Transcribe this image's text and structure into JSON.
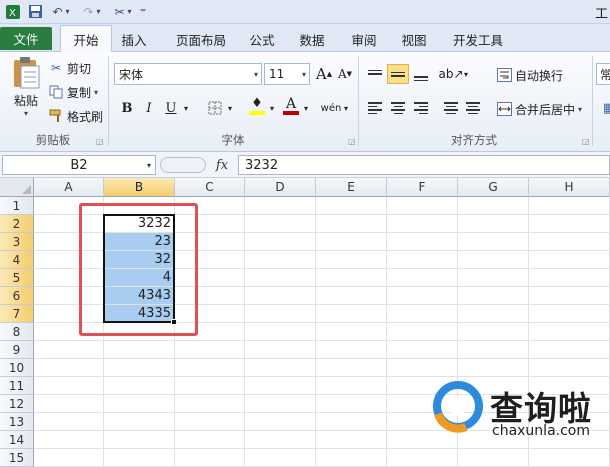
{
  "qat": {
    "title_fragment": "工"
  },
  "tabs": [
    {
      "label": "文件"
    },
    {
      "label": "开始"
    },
    {
      "label": "插入"
    },
    {
      "label": "页面布局"
    },
    {
      "label": "公式"
    },
    {
      "label": "数据"
    },
    {
      "label": "审阅"
    },
    {
      "label": "视图"
    },
    {
      "label": "开发工具"
    }
  ],
  "ribbon": {
    "clipboard": {
      "paste_label": "粘贴",
      "cut_label": "剪切",
      "copy_label": "复制",
      "format_painter_label": "格式刷",
      "group_label": "剪贴板"
    },
    "font": {
      "font_name": "宋体",
      "font_size": "11",
      "bold": "B",
      "italic": "I",
      "underline": "U",
      "grow": "A",
      "shrink": "A",
      "group_label": "字体",
      "font_color": "#c00000",
      "fill_color": "#ffff00"
    },
    "alignment": {
      "wrap_label": "自动换行",
      "merge_label": "合并后居中",
      "group_label": "对齐方式"
    },
    "number": {
      "format_fragment": "常"
    }
  },
  "formula_bar": {
    "name_box": "B2",
    "fx": "fx",
    "content": "3232"
  },
  "grid": {
    "columns": [
      "A",
      "B",
      "C",
      "D",
      "E",
      "F",
      "G",
      "H"
    ],
    "rows": [
      "1",
      "2",
      "3",
      "4",
      "5",
      "6",
      "7",
      "8",
      "9",
      "10",
      "11",
      "12",
      "13",
      "14",
      "15"
    ],
    "selected_column": "B",
    "selected_rows": [
      "2",
      "3",
      "4",
      "5",
      "6",
      "7"
    ],
    "cells_b": [
      {
        "row": "2",
        "value": "3232"
      },
      {
        "row": "3",
        "value": "23"
      },
      {
        "row": "4",
        "value": "32"
      },
      {
        "row": "5",
        "value": "4"
      },
      {
        "row": "6",
        "value": "4343"
      },
      {
        "row": "7",
        "value": "4335"
      }
    ],
    "selection_color": "#a9cdf0",
    "highlight_border_color": "#e05050"
  },
  "watermark": {
    "brand": "查询啦",
    "url": "chaxunla.com"
  }
}
